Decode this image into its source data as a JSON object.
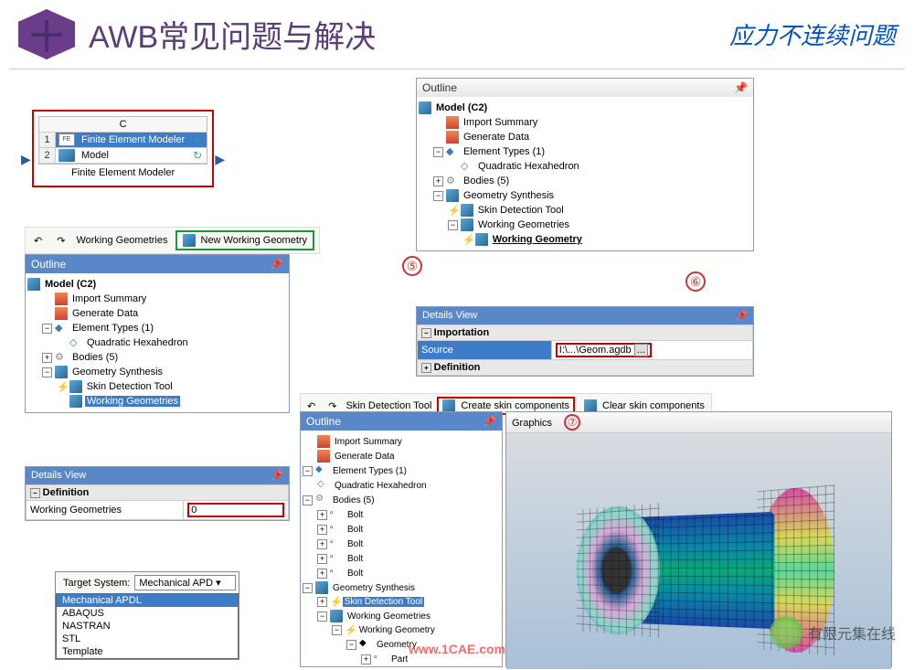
{
  "header": {
    "badge": "十",
    "title": "AWB常见问题与解决",
    "subtitle": "应力不连续问题"
  },
  "system_cell": {
    "column": "C",
    "rows": [
      {
        "num": "1",
        "icon": "FE",
        "text": "Finite Element Modeler",
        "status": "✓"
      },
      {
        "num": "2",
        "icon": "cube",
        "text": "Model",
        "status": "↻"
      }
    ],
    "caption": "Finite Element Modeler"
  },
  "toolbar_left": {
    "undo": "↶",
    "redo": "↷",
    "working_geometries": "Working Geometries",
    "new_wg": "New Working Geometry"
  },
  "outline_left": {
    "title": "Outline",
    "pin": "📌",
    "model": "Model (C2)",
    "items": [
      "Import Summary",
      "Generate Data",
      "Element Types (1)",
      "Quadratic Hexahedron",
      "Bodies (5)",
      "Geometry Synthesis",
      "Skin Detection Tool",
      "Working Geometries"
    ]
  },
  "details_left": {
    "title": "Details View",
    "section": "Definition",
    "row_label": "Working Geometries",
    "row_value": "0"
  },
  "outline_top_right": {
    "title": "Outline",
    "pin": "📌",
    "model": "Model (C2)",
    "items": [
      "Import Summary",
      "Generate Data",
      "Element Types (1)",
      "Quadratic Hexahedron",
      "Bodies (5)",
      "Geometry Synthesis",
      "Skin Detection Tool",
      "Working Geometries",
      "Working Geometry"
    ]
  },
  "details_right": {
    "title": "Details View",
    "section1": "Importation",
    "source_label": "Source",
    "source_value": "I:\\...\\Geom.agdb",
    "browse": "...",
    "section2": "Definition"
  },
  "skin_toolbar": {
    "undo": "↶",
    "redo": "↷",
    "skin_detection": "Skin Detection Tool",
    "create_skin": "Create skin components",
    "clear_skin": "Clear skin components"
  },
  "outline_bottom": {
    "title": "Outline",
    "pin": "📌",
    "items": {
      "import_summary": "Import Summary",
      "generate_data": "Generate Data",
      "element_types": "Element Types (1)",
      "quad_hex": "Quadratic Hexahedron",
      "bodies": "Bodies (5)",
      "bolt": "Bolt",
      "geom_synth": "Geometry Synthesis",
      "skin_det": "Skin Detection Tool",
      "working_geoms": "Working Geometries",
      "working_geom": "Working Geometry",
      "geometry": "Geometry",
      "part": "Part"
    }
  },
  "graphics": {
    "title": "Graphics"
  },
  "target_system": {
    "label": "Target System:",
    "selected": "Mechanical APD",
    "options": [
      "Mechanical APDL",
      "ABAQUS",
      "NASTRAN",
      "STL",
      "Template"
    ]
  },
  "marks": {
    "five": "⑤",
    "six": "⑥",
    "seven": "⑦"
  },
  "watermark": "www.1CAE.com",
  "wx_text": "有限元集在线"
}
